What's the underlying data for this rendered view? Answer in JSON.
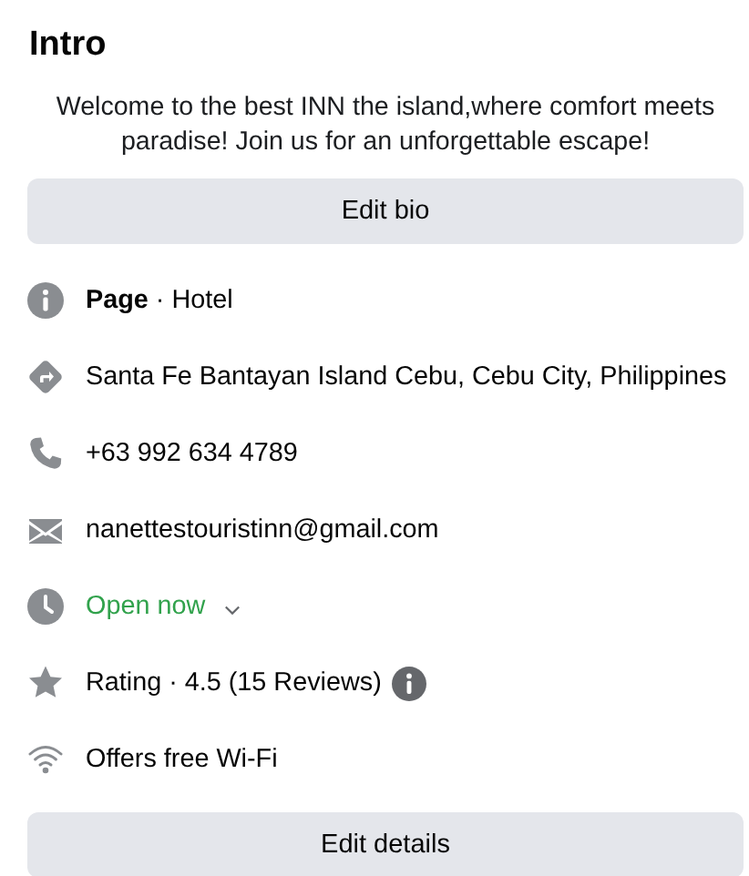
{
  "title": "Intro",
  "bio": "Welcome to the best INN the island,where comfort meets paradise! Join us for an unforgettable escape!",
  "bio_button": "Edit bio",
  "details": [
    {
      "kind": "info",
      "text": "**Page** · Hotel"
    },
    {
      "kind": "directions",
      "text": "Santa Fe Bantayan Island Cebu, Cebu City, Philippines"
    },
    {
      "kind": "phone",
      "text": "+63 992 634 4789"
    },
    {
      "kind": "email",
      "text": "nanettestouristinn@gmail.com"
    },
    {
      "kind": "hours",
      "text": "Open now",
      "open": true
    },
    {
      "kind": "rating",
      "text": "Rating · 4.5 (15 Reviews)"
    },
    {
      "kind": "wifi",
      "text": "Offers free Wi-Fi"
    }
  ],
  "details_button": "Edit details"
}
